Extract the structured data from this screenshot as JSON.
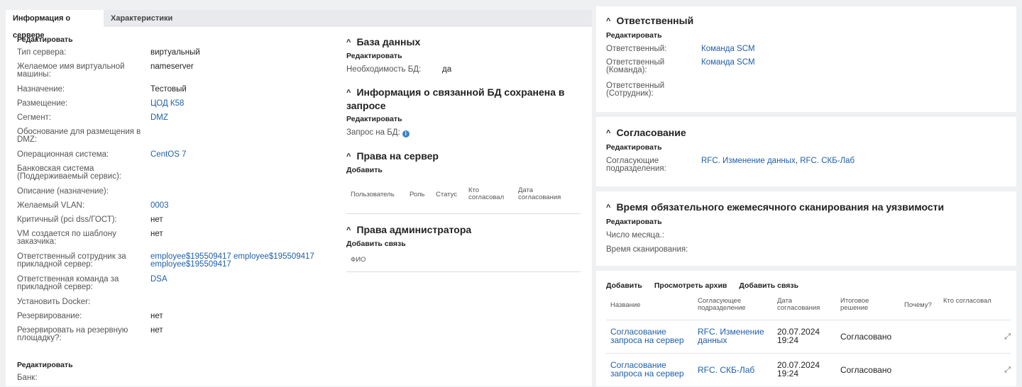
{
  "tabs": [
    {
      "label": "Информация о сервере",
      "active": true
    },
    {
      "label": "Характеристики",
      "active": false
    }
  ],
  "server_info": {
    "edit_label": "Редактировать",
    "fields": [
      {
        "label": "Тип сервера:",
        "value": "виртуальный"
      },
      {
        "label": "Желаемое имя виртуальной машины:",
        "value": "nameserver"
      },
      {
        "label": "Назначение:",
        "value": "Тестовый"
      },
      {
        "label": "Размещение:",
        "value": "ЦОД К58"
      },
      {
        "label": "Сегмент:",
        "value": "DMZ"
      },
      {
        "label": "Обоснование для размещения в DMZ:",
        "value": ""
      },
      {
        "label": "Операционная система:",
        "value": "CentOS 7"
      },
      {
        "label": "Банковская система (Поддерживаемый сервис):",
        "value": ""
      },
      {
        "label": "Описание (назначение):",
        "value": ""
      },
      {
        "label": "Желаемый VLAN:",
        "value": "0003"
      },
      {
        "label": "Критичный (pci dss/ГОСТ):",
        "value": "нет"
      },
      {
        "label": "VM создается по шаблону заказчика:",
        "value": "нет"
      },
      {
        "label": "Ответственный сотрудник за прикладной сервер:",
        "value": "employee$195509417 employee$195509417 employee$195509417"
      },
      {
        "label": "Ответственная команда за прикладной сервер:",
        "value": "DSA"
      },
      {
        "label": "Установить Docker:",
        "value": ""
      },
      {
        "label": "Резервирование:",
        "value": "нет"
      },
      {
        "label": "Резервировать на резервную площадку?:",
        "value": "нет"
      }
    ],
    "edit_label_2": "Редактировать",
    "bank_label": "Банк:"
  },
  "database": {
    "title": "База данных",
    "edit_label": "Редактировать",
    "need_label": "Необходимость БД:",
    "need_value": "да"
  },
  "linked_db": {
    "title": "Информация о связанной БД сохранена в запросе",
    "edit_label": "Редактировать",
    "request_label": "Запрос на БД:"
  },
  "server_rights": {
    "title": "Права на сервер",
    "add_label": "Добавить",
    "columns": [
      "Пользователь",
      "Роль",
      "Статус",
      "Кто согласовал",
      "Дата согласования"
    ]
  },
  "admin_rights": {
    "title": "Права администратора",
    "add_link_label": "Добавить связь",
    "columns": [
      "ФИО"
    ]
  },
  "responsible": {
    "title": "Ответственный",
    "edit_label": "Редактировать",
    "fields": [
      {
        "label": "Ответственный:",
        "value": "Команда SCM"
      },
      {
        "label": "Ответственный (Команда):",
        "value": "Команда SCM"
      },
      {
        "label": "Ответственный (Сотрудник):",
        "value": ""
      }
    ]
  },
  "approval": {
    "title": "Согласование",
    "edit_label": "Редактировать",
    "label": "Согласующие подразделения:",
    "value_1": "RFC. Изменение данных",
    "separator": ", ",
    "value_2": "RFC. СКБ-Лаб"
  },
  "scan_time": {
    "title": "Время обязательного ежемесячного сканирования на уязвимости",
    "edit_label": "Редактировать",
    "day_label": "Число месяца.:",
    "time_label": "Время сканирования:"
  },
  "approvals_table": {
    "toolbar": [
      "Добавить",
      "Просмотреть архив",
      "Добавить связь"
    ],
    "columns": [
      "Название",
      "Согласующее подразделение",
      "Дата согласования",
      "Итоговое решение",
      "Почему?",
      "Кто согласовал"
    ],
    "rows": [
      {
        "name": "Согласование запроса на сервер",
        "dept": "RFC. Изменение данных",
        "date": "20.07.2024 19:24",
        "decision": "Согласовано"
      },
      {
        "name": "Согласование запроса на сервер",
        "dept": "RFC. СКБ-Лаб",
        "date": "20.07.2024 19:24",
        "decision": "Согласовано"
      }
    ]
  },
  "icons": {
    "chevron": "chevron-up-icon",
    "info": "info-icon",
    "expand": "expand-icon"
  },
  "colors": {
    "link": "#1f5fa8",
    "background": "#eef0f2",
    "panel": "#ffffff"
  }
}
